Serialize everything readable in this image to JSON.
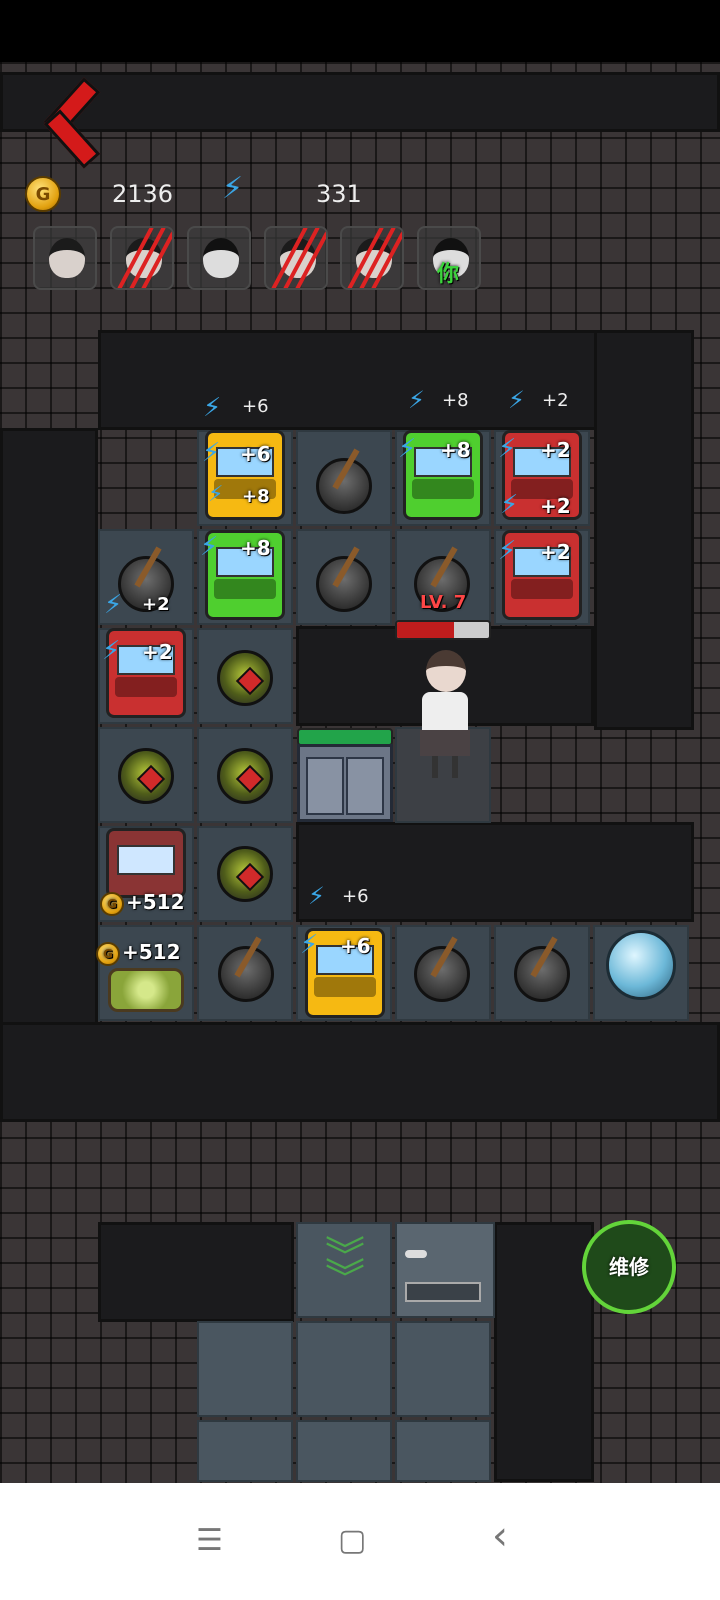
{
  "hud": {
    "coins": "2136",
    "energy": "331",
    "coin_icon_letter": "G"
  },
  "players": [
    "avatar",
    "slashed",
    "ghost",
    "slashed",
    "slashed",
    "self"
  ],
  "self_label": "你",
  "top_bonuses": [
    "+6",
    "+8",
    "+2"
  ],
  "items": {
    "arcade1_bonus": "+6",
    "arcade1_sub": "+8",
    "arcade2_bonus": "+8",
    "arcade3_bonus": "+2",
    "arcade3_sub": "+2",
    "arcade4_bonus": "+8",
    "arcade5_bonus": "+2",
    "pot_bonus": "+2",
    "arcade6_bonus": "+2",
    "level": "LV. 7",
    "coin_bonus1": "+512",
    "coin_bonus2": "+512",
    "bottom_bonus": "+6",
    "arcade7_bonus": "+6"
  },
  "repair_label": "维修",
  "nav": {
    "menu": "☰",
    "home": "▢",
    "back": "‹"
  }
}
